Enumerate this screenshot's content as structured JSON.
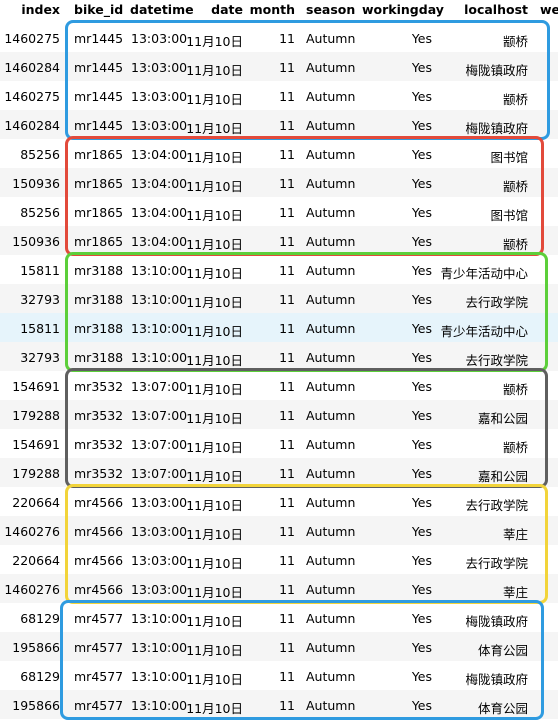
{
  "columns": [
    "index",
    "bike_id",
    "datetime",
    "date",
    "month",
    "season",
    "workingday",
    "localhost",
    "we"
  ],
  "rows": [
    [
      "1460275",
      "mr1445",
      "13:03:00",
      "11月10日",
      "11",
      "Autumn",
      "Yes",
      "颛桥"
    ],
    [
      "1460284",
      "mr1445",
      "13:03:00",
      "11月10日",
      "11",
      "Autumn",
      "Yes",
      "梅陇镇政府"
    ],
    [
      "1460275",
      "mr1445",
      "13:03:00",
      "11月10日",
      "11",
      "Autumn",
      "Yes",
      "颛桥"
    ],
    [
      "1460284",
      "mr1445",
      "13:03:00",
      "11月10日",
      "11",
      "Autumn",
      "Yes",
      "梅陇镇政府"
    ],
    [
      "85256",
      "mr1865",
      "13:04:00",
      "11月10日",
      "11",
      "Autumn",
      "Yes",
      "图书馆"
    ],
    [
      "150936",
      "mr1865",
      "13:04:00",
      "11月10日",
      "11",
      "Autumn",
      "Yes",
      "颛桥"
    ],
    [
      "85256",
      "mr1865",
      "13:04:00",
      "11月10日",
      "11",
      "Autumn",
      "Yes",
      "图书馆"
    ],
    [
      "150936",
      "mr1865",
      "13:04:00",
      "11月10日",
      "11",
      "Autumn",
      "Yes",
      "颛桥"
    ],
    [
      "15811",
      "mr3188",
      "13:10:00",
      "11月10日",
      "11",
      "Autumn",
      "Yes",
      "青少年活动中心"
    ],
    [
      "32793",
      "mr3188",
      "13:10:00",
      "11月10日",
      "11",
      "Autumn",
      "Yes",
      "去行政学院"
    ],
    [
      "15811",
      "mr3188",
      "13:10:00",
      "11月10日",
      "11",
      "Autumn",
      "Yes",
      "青少年活动中心"
    ],
    [
      "32793",
      "mr3188",
      "13:10:00",
      "11月10日",
      "11",
      "Autumn",
      "Yes",
      "去行政学院"
    ],
    [
      "154691",
      "mr3532",
      "13:07:00",
      "11月10日",
      "11",
      "Autumn",
      "Yes",
      "颛桥"
    ],
    [
      "179288",
      "mr3532",
      "13:07:00",
      "11月10日",
      "11",
      "Autumn",
      "Yes",
      "嘉和公园"
    ],
    [
      "154691",
      "mr3532",
      "13:07:00",
      "11月10日",
      "11",
      "Autumn",
      "Yes",
      "颛桥"
    ],
    [
      "179288",
      "mr3532",
      "13:07:00",
      "11月10日",
      "11",
      "Autumn",
      "Yes",
      "嘉和公园"
    ],
    [
      "220664",
      "mr4566",
      "13:03:00",
      "11月10日",
      "11",
      "Autumn",
      "Yes",
      "去行政学院"
    ],
    [
      "1460276",
      "mr4566",
      "13:03:00",
      "11月10日",
      "11",
      "Autumn",
      "Yes",
      "莘庄"
    ],
    [
      "220664",
      "mr4566",
      "13:03:00",
      "11月10日",
      "11",
      "Autumn",
      "Yes",
      "去行政学院"
    ],
    [
      "1460276",
      "mr4566",
      "13:03:00",
      "11月10日",
      "11",
      "Autumn",
      "Yes",
      "莘庄"
    ],
    [
      "68129",
      "mr4577",
      "13:10:00",
      "11月10日",
      "11",
      "Autumn",
      "Yes",
      "梅陇镇政府"
    ],
    [
      "195866",
      "mr4577",
      "13:10:00",
      "11月10日",
      "11",
      "Autumn",
      "Yes",
      "体育公园"
    ],
    [
      "68129",
      "mr4577",
      "13:10:00",
      "11月10日",
      "11",
      "Autumn",
      "Yes",
      "梅陇镇政府"
    ],
    [
      "195866",
      "mr4577",
      "13:10:00",
      "11月10日",
      "11",
      "Autumn",
      "Yes",
      "体育公园"
    ]
  ],
  "highlighted_row": 10,
  "colors": {
    "stripe": "#f5f5f5",
    "hover": "#e6f4fb",
    "box_colors": [
      "#2f9be0",
      "#e24a3b",
      "#5ccf3a",
      "#5f5f5f",
      "#f2d43a",
      "#2f9be0"
    ]
  }
}
